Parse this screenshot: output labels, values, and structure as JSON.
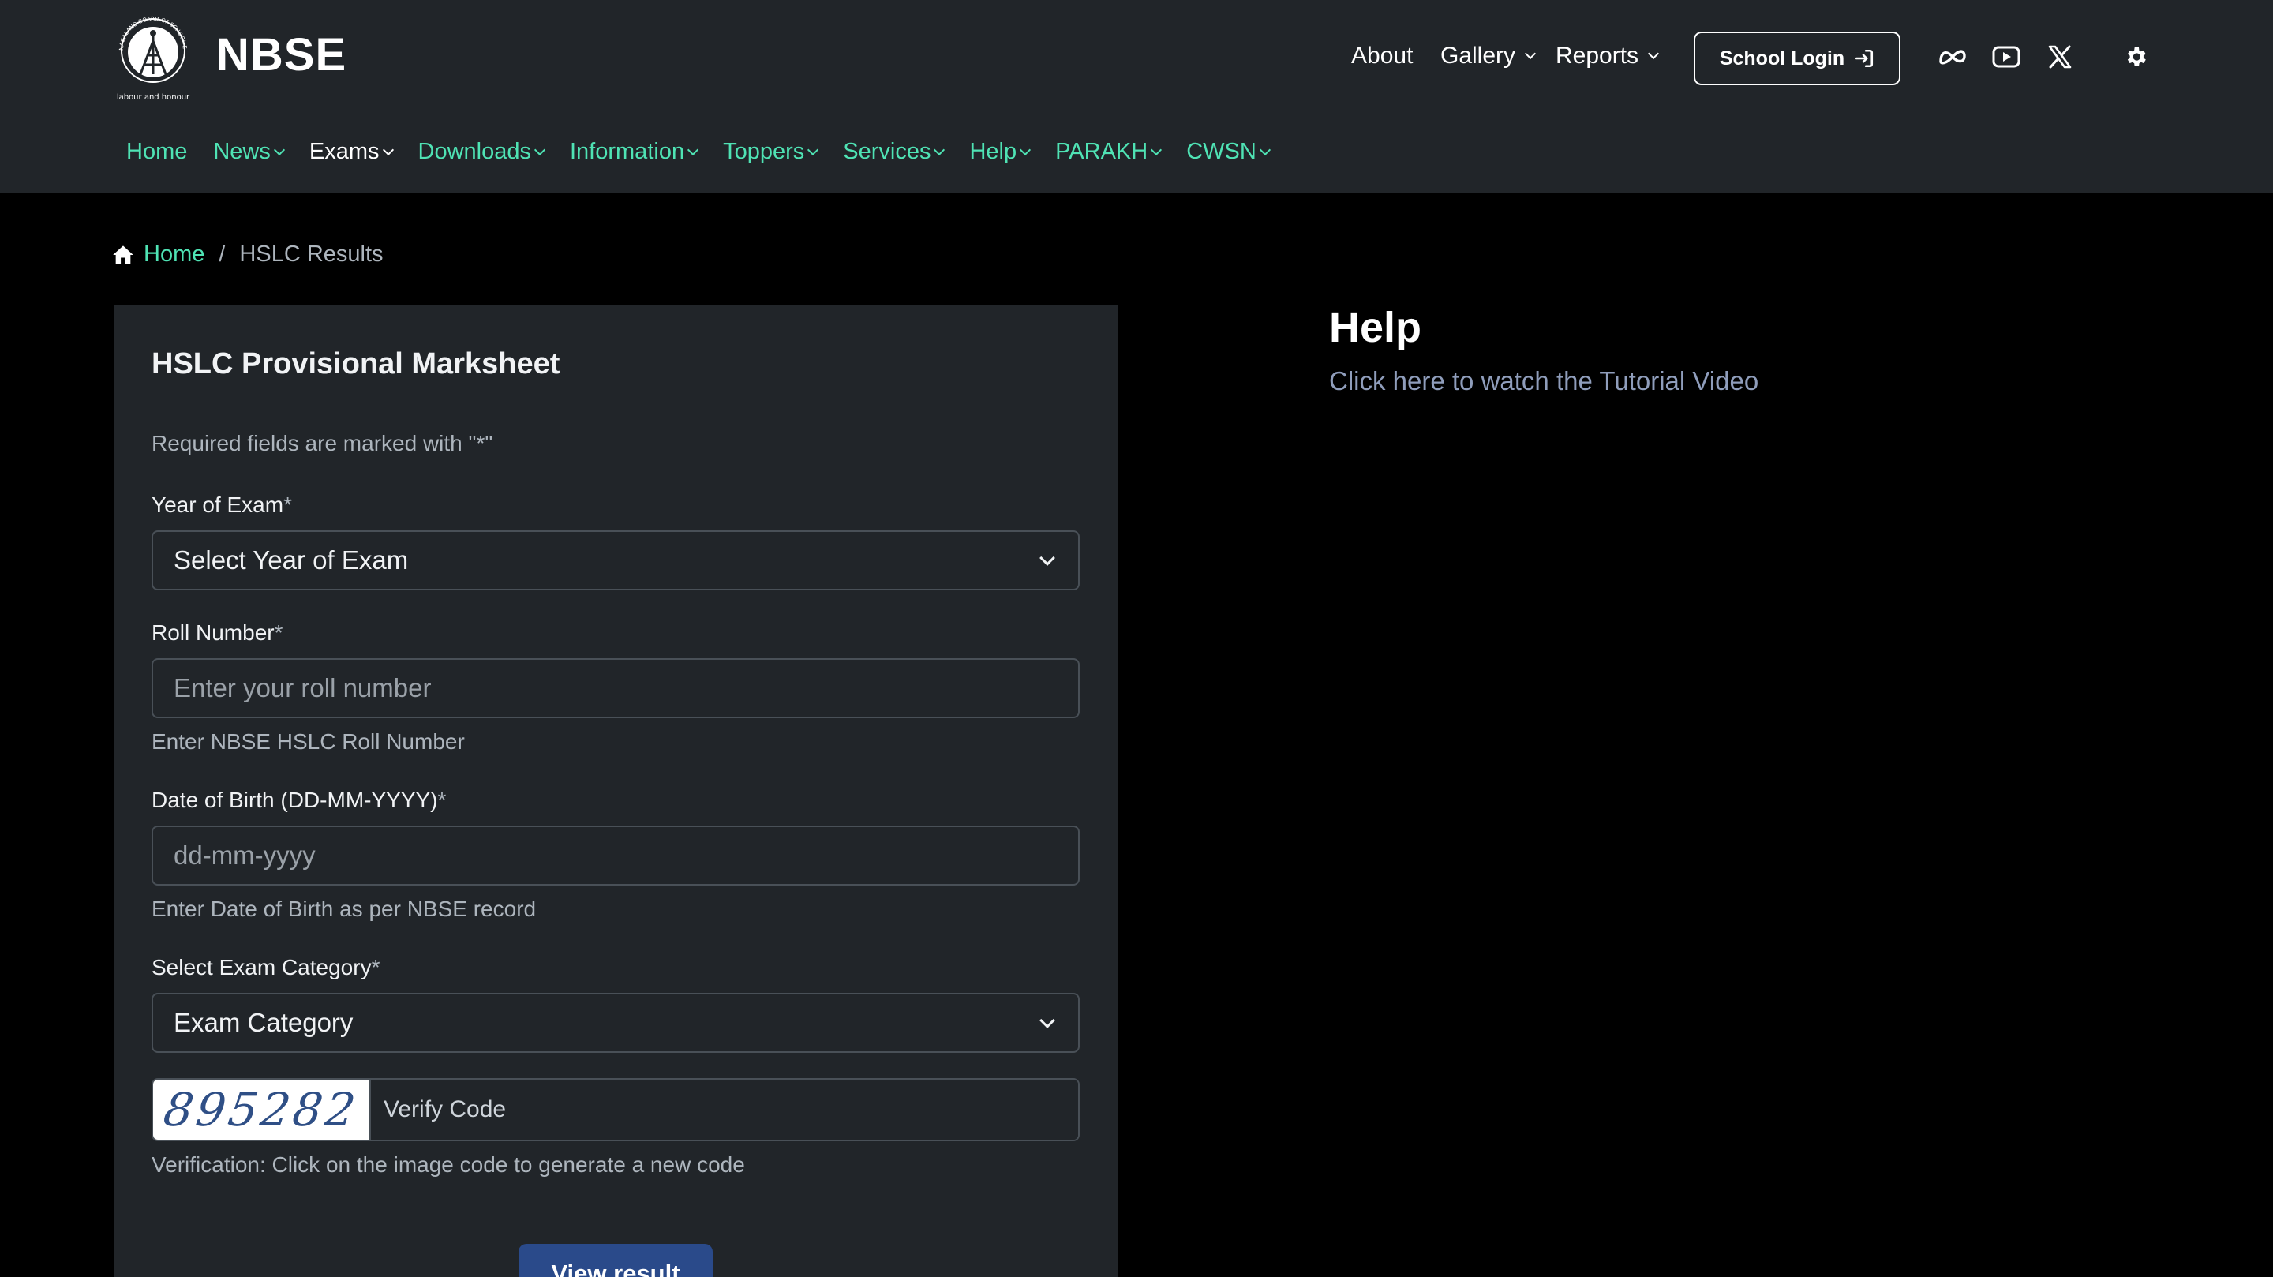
{
  "header": {
    "brand": "NBSE",
    "logo_ring_text": "NAGALAND BOARD OF SCHOOL EDUCATION",
    "logo_motto": "labour and honour",
    "utility_links": [
      {
        "label": "About",
        "dropdown": false
      },
      {
        "label": "Gallery",
        "dropdown": true
      },
      {
        "label": "Reports",
        "dropdown": true
      }
    ],
    "login_label": "School Login",
    "social_icons": [
      "meta-icon",
      "youtube-icon",
      "x-twitter-icon"
    ],
    "settings_icon": "gear-icon"
  },
  "nav": {
    "items": [
      {
        "label": "Home",
        "dropdown": false
      },
      {
        "label": "News",
        "dropdown": true
      },
      {
        "label": "Exams",
        "dropdown": true,
        "active": true
      },
      {
        "label": "Downloads",
        "dropdown": true
      },
      {
        "label": "Information",
        "dropdown": true
      },
      {
        "label": "Toppers",
        "dropdown": true
      },
      {
        "label": "Services",
        "dropdown": true
      },
      {
        "label": "Help",
        "dropdown": true
      },
      {
        "label": "PARAKH",
        "dropdown": true
      },
      {
        "label": "CWSN",
        "dropdown": true
      }
    ]
  },
  "breadcrumb": {
    "home": "Home",
    "separator": "/",
    "current": "HSLC Results"
  },
  "form": {
    "title": "HSLC Provisional Marksheet",
    "required_note": "Required fields are marked with \"*\"",
    "year": {
      "label": "Year of Exam",
      "value": "Select Year of Exam"
    },
    "roll": {
      "label": "Roll Number",
      "placeholder": "Enter your roll number",
      "hint": "Enter NBSE HSLC Roll Number"
    },
    "dob": {
      "label": "Date of Birth (DD-MM-YYYY)",
      "placeholder": "dd-mm-yyyy",
      "hint": "Enter Date of Birth as per NBSE record"
    },
    "category": {
      "label": "Select Exam Category",
      "value": "Exam Category"
    },
    "captcha": {
      "code": "895282",
      "placeholder": "Verify Code",
      "hint": "Verification: Click on the image code to generate a new code"
    },
    "submit_label": "View result",
    "required_mark": "*"
  },
  "help": {
    "title": "Help",
    "link": "Click here to watch the Tutorial Video"
  },
  "colors": {
    "header_bg": "#212529",
    "page_bg": "#000000",
    "nav_accent": "#4fe3b4",
    "button_primary": "#2a4a8a",
    "help_link": "#8f9dbb"
  }
}
